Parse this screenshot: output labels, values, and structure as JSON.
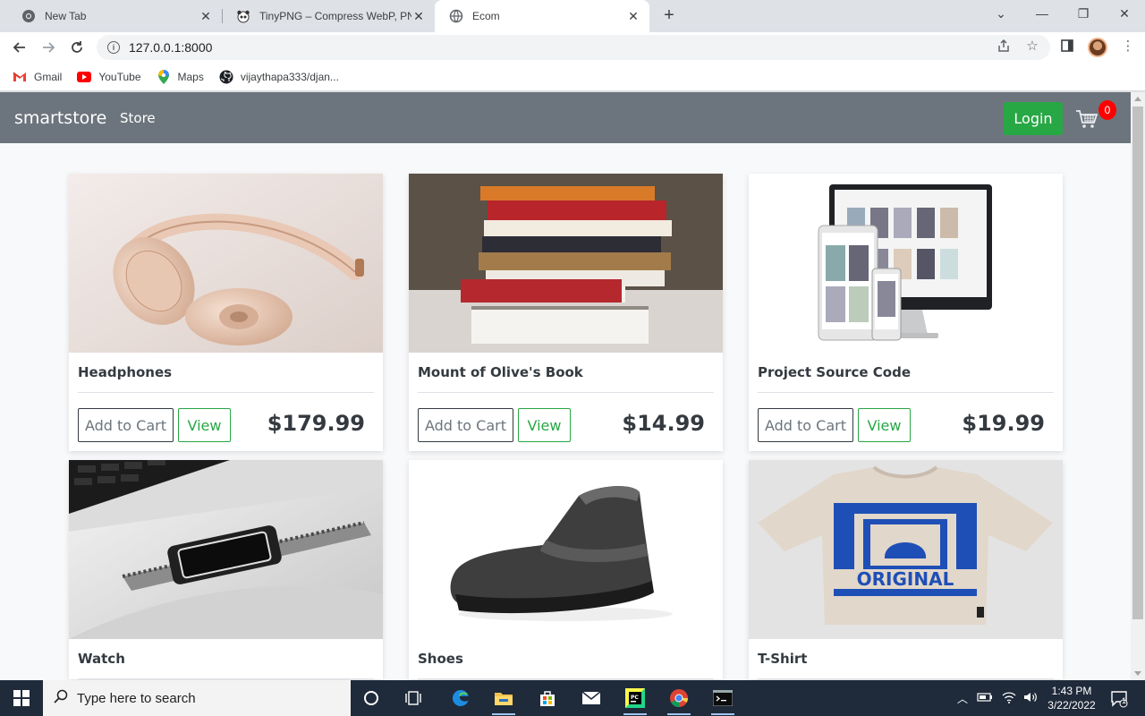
{
  "browser": {
    "tabs": [
      {
        "title": "New Tab",
        "icon": "chrome-icon"
      },
      {
        "title": "TinyPNG – Compress WebP, PNG",
        "icon": "tinypng-panda-icon"
      },
      {
        "title": "Ecom",
        "icon": "globe-icon",
        "active": true
      }
    ],
    "url": "127.0.0.1:8000",
    "bookmarks": [
      {
        "label": "Gmail",
        "icon": "gmail-icon"
      },
      {
        "label": "YouTube",
        "icon": "youtube-icon"
      },
      {
        "label": "Maps",
        "icon": "maps-icon"
      },
      {
        "label": "vijaythapa333/djan...",
        "icon": "github-icon"
      }
    ]
  },
  "navbar": {
    "brand": "smartstore",
    "store_link": "Store",
    "login_label": "Login",
    "cart_count": "0",
    "colors": {
      "navbar_bg": "#6c757d",
      "login_bg": "#28a745",
      "badge": "#ff0000"
    }
  },
  "products": [
    {
      "name": "Headphones",
      "price": "$179.99",
      "add_label": "Add to Cart",
      "view_label": "View",
      "image": "headphones-image"
    },
    {
      "name": "Mount of Olive's Book",
      "price": "$14.99",
      "add_label": "Add to Cart",
      "view_label": "View",
      "image": "book-stack-image"
    },
    {
      "name": "Project Source Code",
      "price": "$19.99",
      "add_label": "Add to Cart",
      "view_label": "View",
      "image": "responsive-devices-image"
    },
    {
      "name": "Watch",
      "image": "smartwatch-image"
    },
    {
      "name": "Shoes",
      "image": "sneaker-image"
    },
    {
      "name": "T-Shirt",
      "image": "tshirt-image"
    }
  ],
  "taskbar": {
    "search_placeholder": "Type here to search",
    "time": "1:43 PM",
    "date": "3/22/2022",
    "notification_count": "1"
  }
}
